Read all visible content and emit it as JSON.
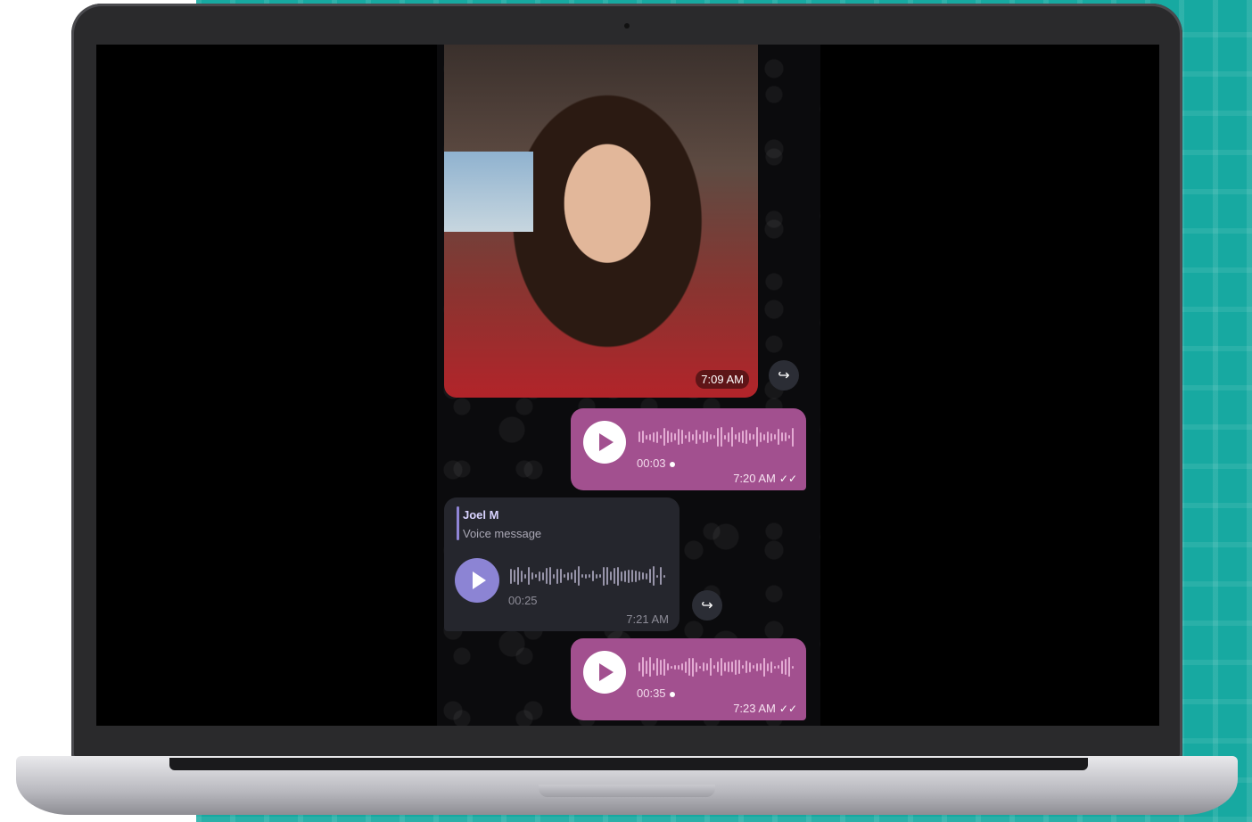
{
  "chat": {
    "photo_message": {
      "time": "7:09 AM"
    },
    "voice_out_1": {
      "duration": "00:03",
      "time": "7:20 AM",
      "checks": "✓✓"
    },
    "voice_in": {
      "reply_name": "Joel M",
      "reply_text": "Voice message",
      "duration": "00:25",
      "time": "7:21 AM"
    },
    "voice_out_2": {
      "duration": "00:35",
      "time": "7:23 AM",
      "checks": "✓✓"
    },
    "forward_icon": "↪"
  },
  "colors": {
    "outgoing_bubble": "#a2508f",
    "incoming_bubble": "#25262d",
    "accent_purple": "#8c84d4",
    "backdrop_teal": "#17a9a1"
  },
  "icons": [
    "play-icon",
    "forward-icon",
    "double-check-icon",
    "camera-icon"
  ]
}
